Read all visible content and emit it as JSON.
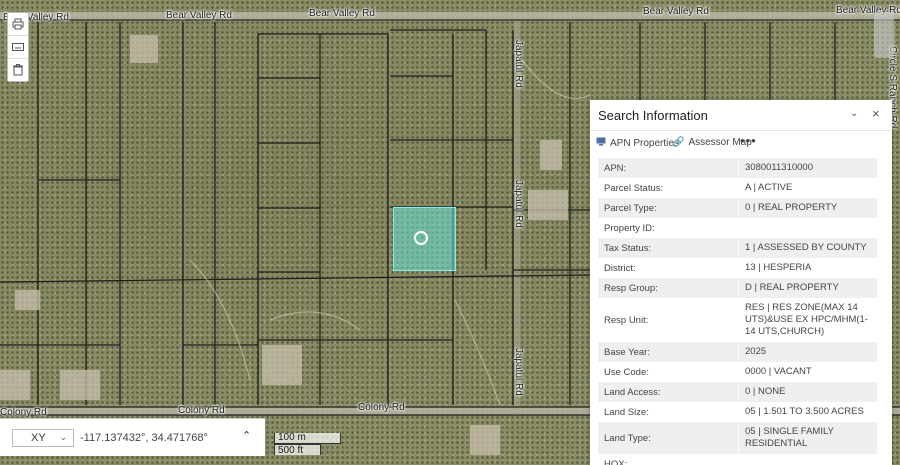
{
  "map": {
    "roads": {
      "bear_valley_west": "Bear Valley Rd",
      "bear_valley_mid": "Bear Valley Rd",
      "bear_valley_east1": "Bear Valley Rd",
      "bear_valley_east2": "Bear Valley Rd",
      "left_edge": "Bear Valley Rd",
      "colony_west": "Colony Rd",
      "colony_mid": "Colony Rd",
      "japatul_north": "Japatul Rd",
      "japatul_mid": "Japatul Rd",
      "japatul_south": "Japatul Rd",
      "circle_s_ranch": "Circle S Ranch Rd"
    },
    "toolbar": {
      "tool1_icon": "print-icon",
      "tool2_icon": "keyboard-icon",
      "tool3_icon": "trash-icon"
    }
  },
  "coords": {
    "mode": "XY",
    "value": "-117.137432°, 34.471768°"
  },
  "scale": {
    "metric": "100 m",
    "imperial": "500 ft"
  },
  "panel": {
    "title": "Search Information",
    "actions": {
      "apn_properties": "APN Properties",
      "assessor_map": "Assessor Map",
      "more": "•••"
    },
    "rows": [
      {
        "label": "APN:",
        "value": "3080011310000"
      },
      {
        "label": "Parcel Status:",
        "value": "A | ACTIVE"
      },
      {
        "label": "Parcel Type:",
        "value": "0 | REAL PROPERTY"
      },
      {
        "label": "Property ID:",
        "value": ""
      },
      {
        "label": "Tax Status:",
        "value": "1 | ASSESSED BY COUNTY"
      },
      {
        "label": "District:",
        "value": "13 | HESPERIA"
      },
      {
        "label": "Resp Group:",
        "value": "D | REAL PROPERTY"
      },
      {
        "label": "Resp Unit:",
        "value": "RES | RES ZONE(MAX 14 UTS)&USE EX HPC/MHM(1-14 UTS,CHURCH)"
      },
      {
        "label": "Base Year:",
        "value": "2025"
      },
      {
        "label": "Use Code:",
        "value": "0000 | VACANT"
      },
      {
        "label": "Land Access:",
        "value": "0 | NONE"
      },
      {
        "label": "Land Size:",
        "value": "05 | 1.501 TO 3.500 ACRES"
      },
      {
        "label": "Land Type:",
        "value": "05 | SINGLE FAMILY RESIDENTIAL"
      },
      {
        "label": "HOX:",
        "value": ""
      }
    ]
  },
  "colors": {
    "highlight": "#64e1d7",
    "panel_bg": "#ffffff",
    "row_alt": "#efefef"
  }
}
